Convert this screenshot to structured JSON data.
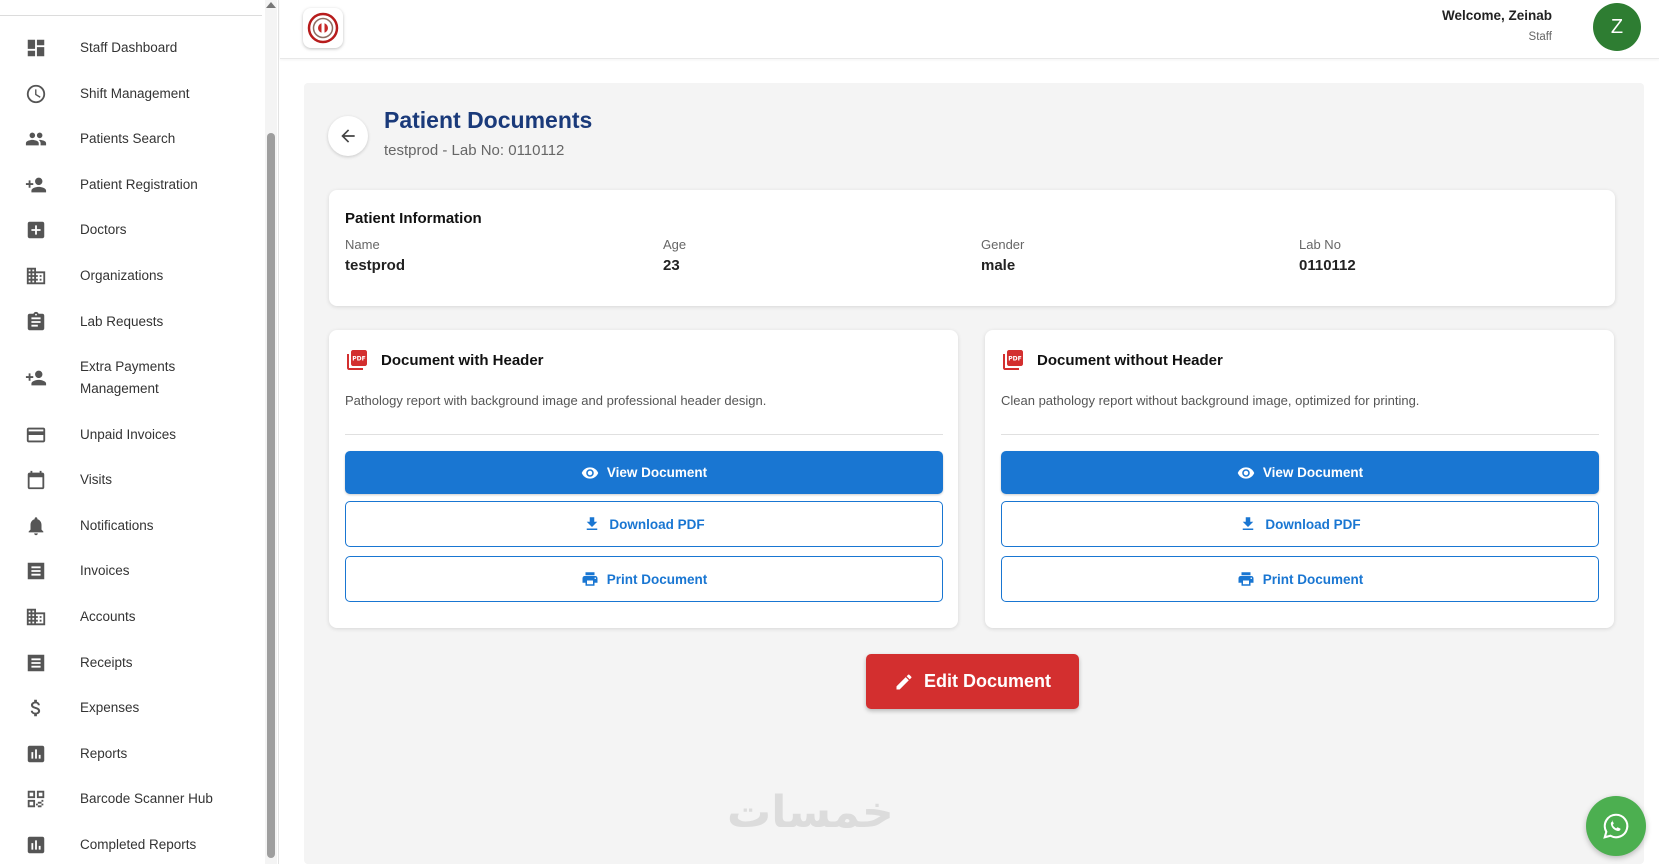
{
  "sidebar": {
    "items": [
      {
        "label": "Staff Dashboard",
        "icon": "dashboard-icon"
      },
      {
        "label": "Shift Management",
        "icon": "clock-icon"
      },
      {
        "label": "Patients Search",
        "icon": "people-icon"
      },
      {
        "label": "Patient Registration",
        "icon": "person-add-icon"
      },
      {
        "label": "Doctors",
        "icon": "medical-plus-icon"
      },
      {
        "label": "Organizations",
        "icon": "building-icon"
      },
      {
        "label": "Lab Requests",
        "icon": "clipboard-icon"
      },
      {
        "label": "Extra Payments",
        "label2": "Management",
        "icon": "person-add-icon"
      },
      {
        "label": "Unpaid Invoices",
        "icon": "credit-card-icon"
      },
      {
        "label": "Visits",
        "icon": "calendar-icon"
      },
      {
        "label": "Notifications",
        "icon": "bell-icon"
      },
      {
        "label": "Invoices",
        "icon": "receipt-icon"
      },
      {
        "label": "Accounts",
        "icon": "building-icon"
      },
      {
        "label": "Receipts",
        "icon": "receipt-icon"
      },
      {
        "label": "Expenses",
        "icon": "dollar-icon"
      },
      {
        "label": "Reports",
        "icon": "bar-chart-icon"
      },
      {
        "label": "Barcode Scanner Hub",
        "icon": "qr-code-icon"
      },
      {
        "label": "Completed Reports",
        "icon": "bar-chart-icon"
      }
    ]
  },
  "header": {
    "welcome": "Welcome, Zeinab",
    "role": "Staff",
    "avatar_letter": "Z",
    "avatar_color": "#2e7d32"
  },
  "page": {
    "title": "Patient Documents",
    "subtitle": "testprod - Lab No: 0110112"
  },
  "patient_info": {
    "title": "Patient Information",
    "fields": [
      {
        "label": "Name",
        "value": "testprod"
      },
      {
        "label": "Age",
        "value": "23"
      },
      {
        "label": "Gender",
        "value": "male"
      },
      {
        "label": "Lab No",
        "value": "0110112"
      }
    ]
  },
  "documents": [
    {
      "title": "Document with Header",
      "description": "Pathology report with background image and professional header design.",
      "view_label": "View Document",
      "download_label": "Download PDF",
      "print_label": "Print Document"
    },
    {
      "title": "Document without Header",
      "description": "Clean pathology report without background image, optimized for printing.",
      "view_label": "View Document",
      "download_label": "Download PDF",
      "print_label": "Print Document"
    }
  ],
  "edit_button": {
    "label": "Edit Document"
  },
  "watermark": "خمسات",
  "colors": {
    "primary": "#1976d2",
    "danger": "#d32f2f",
    "title": "#1a3a7a",
    "whatsapp": "#4caf50"
  }
}
